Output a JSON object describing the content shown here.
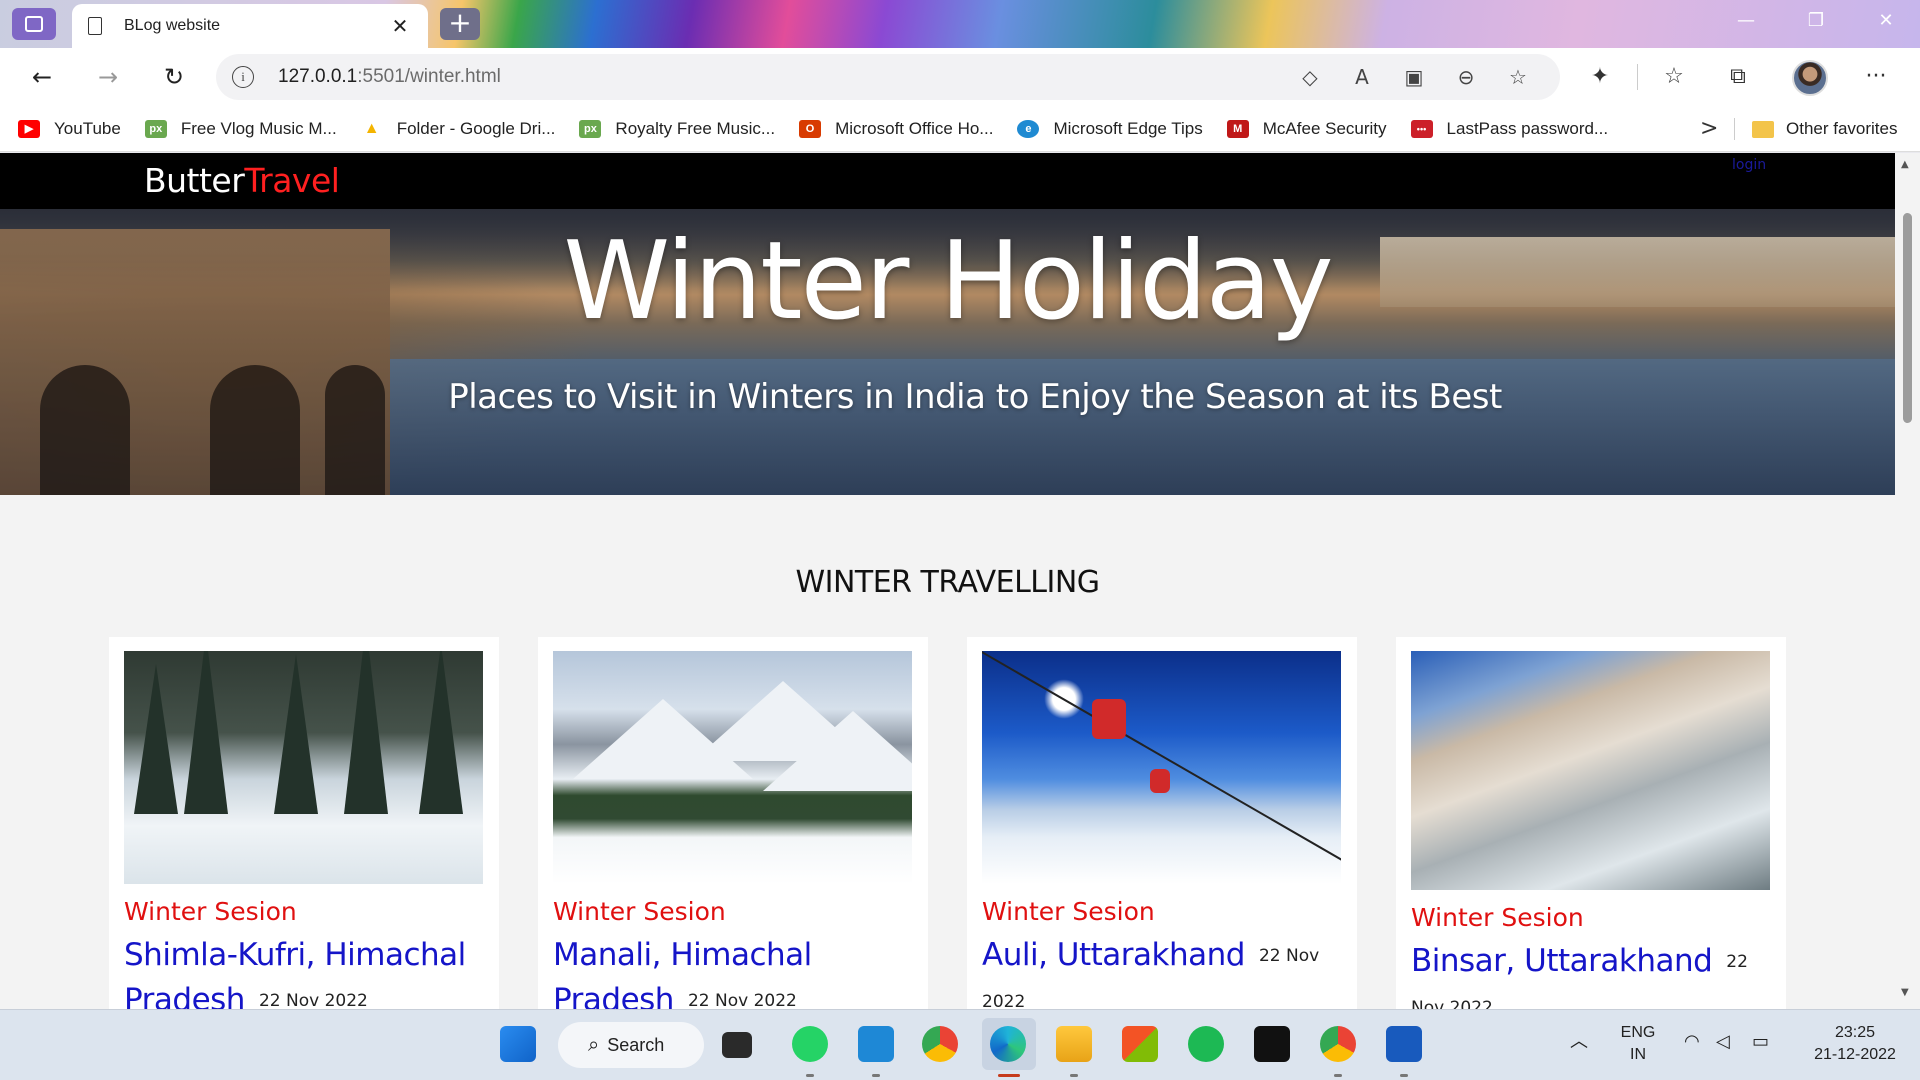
{
  "browser": {
    "tab_title": "BLog website",
    "tab_close": "✕",
    "new_tab": "+",
    "url_host": "127.0.0.1",
    "url_path": ":5501/winter.html",
    "window_controls": [
      "—",
      "❐",
      "✕"
    ],
    "nav_icons": [
      "back-icon",
      "forward-icon",
      "refresh-icon"
    ]
  },
  "favorites": {
    "items": [
      {
        "label": "YouTube",
        "icon": "youtube-icon",
        "color": "#ff0000",
        "glyph": "▶"
      },
      {
        "label": "Free Vlog Music M...",
        "icon": "pexels-icon",
        "color": "#6aa84f",
        "glyph": "px"
      },
      {
        "label": "Folder - Google Dri...",
        "icon": "google-drive-icon",
        "color": "#f4b400",
        "glyph": "▲"
      },
      {
        "label": "Royalty Free Music...",
        "icon": "pexels-icon",
        "color": "#6aa84f",
        "glyph": "px"
      },
      {
        "label": "Microsoft Office Ho...",
        "icon": "office-icon",
        "color": "#d83b01",
        "glyph": "O"
      },
      {
        "label": "Microsoft Edge Tips",
        "icon": "edge-icon",
        "color": "#1f8ad2",
        "glyph": "e"
      },
      {
        "label": "McAfee Security",
        "icon": "mcafee-icon",
        "color": "#c01818",
        "glyph": "M"
      },
      {
        "label": "LastPass password...",
        "icon": "lastpass-icon",
        "color": "#cc2029",
        "glyph": "•••"
      }
    ],
    "more": ">",
    "other": "Other favorites"
  },
  "site": {
    "logo_main": "Butter",
    "logo_accent": "Travel",
    "login": "login",
    "hero_title": "Winter Holiday",
    "hero_subtitle": "Places to Visit in Winters in India to Enjoy the Season at its Best",
    "section_title": "WINTER TRAVELLING",
    "cards": [
      {
        "tag": "Winter Sesion",
        "place": "Shimla-Kufri, Himachal Pradesh",
        "date": "22 Nov 2022"
      },
      {
        "tag": "Winter Sesion",
        "place": "Manali, Himachal Pradesh",
        "date": "22 Nov 2022"
      },
      {
        "tag": "Winter Sesion",
        "place": "Auli, Uttarakhand",
        "date": "22 Nov 2022"
      },
      {
        "tag": "Winter Sesion",
        "place": "Binsar, Uttarakhand",
        "date": "22 Nov 2022"
      }
    ]
  },
  "taskbar": {
    "search_label": "Search",
    "lang_top": "ENG",
    "lang_bottom": "IN",
    "time": "23:25",
    "date": "21-12-2022"
  }
}
